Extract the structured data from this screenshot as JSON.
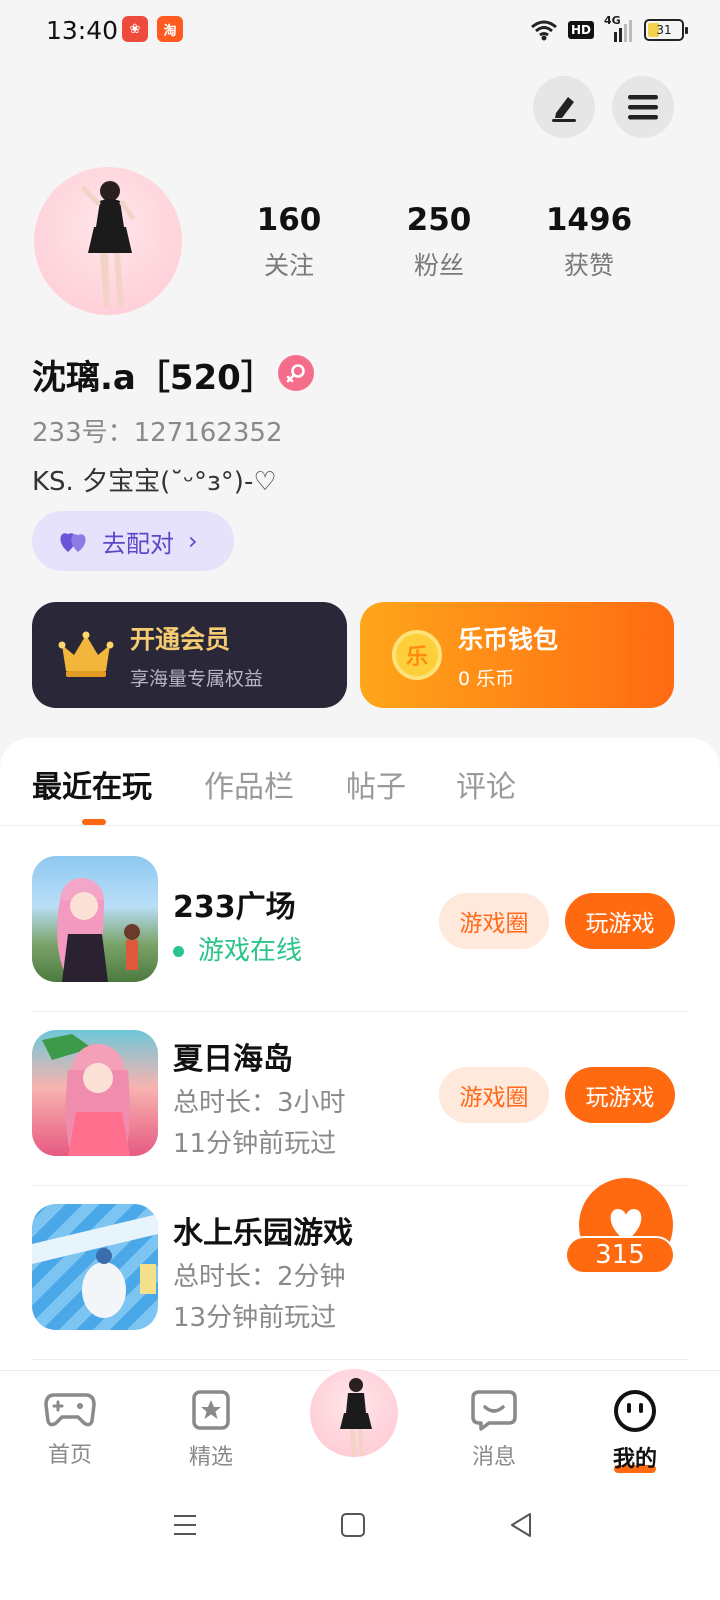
{
  "status_bar": {
    "time": "13:40",
    "hd": "HD",
    "network": "4G",
    "battery": "31"
  },
  "profile": {
    "stats": [
      {
        "value": "160",
        "label": "关注"
      },
      {
        "value": "250",
        "label": "粉丝"
      },
      {
        "value": "1496",
        "label": "获赞"
      }
    ],
    "nickname": "沈璃.a［520］",
    "uid": "233号：127162352",
    "bio": "KS. 夕宝宝(˘ᵕ°з°)-♡",
    "match_label": "去配对"
  },
  "cards": {
    "vip": {
      "title": "开通会员",
      "subtitle": "享海量专属权益"
    },
    "wallet": {
      "title": "乐币钱包",
      "subtitle": "0 乐币",
      "coin_char": "乐"
    }
  },
  "tabs": [
    "最近在玩",
    "作品栏",
    "帖子",
    "评论"
  ],
  "games": [
    {
      "name": "233广场",
      "status": "游戏在线",
      "circle_label": "游戏圈",
      "play_label": "玩游戏"
    },
    {
      "name": "夏日海岛",
      "duration": "总时长：3小时",
      "last_played": "11分钟前玩过",
      "circle_label": "游戏圈",
      "play_label": "玩游戏"
    },
    {
      "name": "水上乐园游戏",
      "duration": "总时长：2分钟",
      "last_played": "13分钟前玩过"
    }
  ],
  "like_fab": {
    "count": "315"
  },
  "bottom_nav": [
    {
      "label": "首页",
      "icon": "gamepad-icon"
    },
    {
      "label": "精选",
      "icon": "star-badge-icon"
    },
    {
      "label": "消息",
      "icon": "chat-icon"
    },
    {
      "label": "我的",
      "icon": "face-icon"
    }
  ],
  "colors": {
    "accent": "#ff6a10",
    "online": "#2bc48a",
    "vip_gold": "#f5cc72",
    "match_purple": "#5b48c6"
  }
}
